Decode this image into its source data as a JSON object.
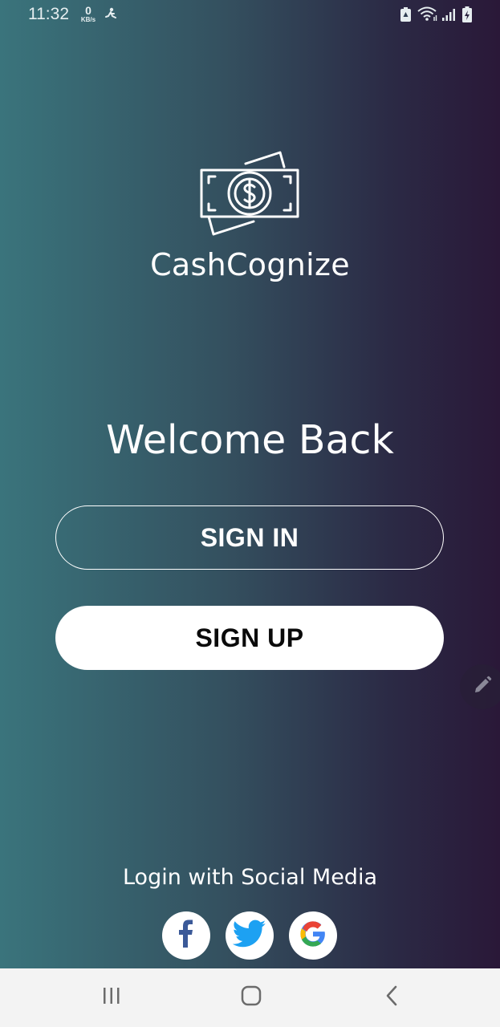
{
  "status_bar": {
    "time": "11:32",
    "net_speed_value": "0",
    "net_speed_unit": "KB/s",
    "icons": [
      "runner-icon",
      "battery-saver-icon",
      "wifi-icon",
      "signal-icon",
      "battery-charging-icon"
    ]
  },
  "app": {
    "name": "CashCognize",
    "logo_icon": "money-bill-icon"
  },
  "welcome": {
    "title": "Welcome Back",
    "sign_in_label": "SIGN IN",
    "sign_up_label": "SIGN UP"
  },
  "social": {
    "caption": "Login with Social Media",
    "providers": [
      "facebook-icon",
      "twitter-icon",
      "google-icon"
    ]
  },
  "nav_bar": {
    "buttons": [
      "recent-apps-icon",
      "home-icon",
      "back-icon"
    ]
  },
  "colors": {
    "gradient_left": "#3a747c",
    "gradient_right": "#2a1838",
    "facebook": "#3b5998",
    "twitter": "#1da1f2",
    "google_blue": "#4285f4",
    "google_red": "#ea4335",
    "google_yellow": "#fbbc05",
    "google_green": "#34a853"
  }
}
